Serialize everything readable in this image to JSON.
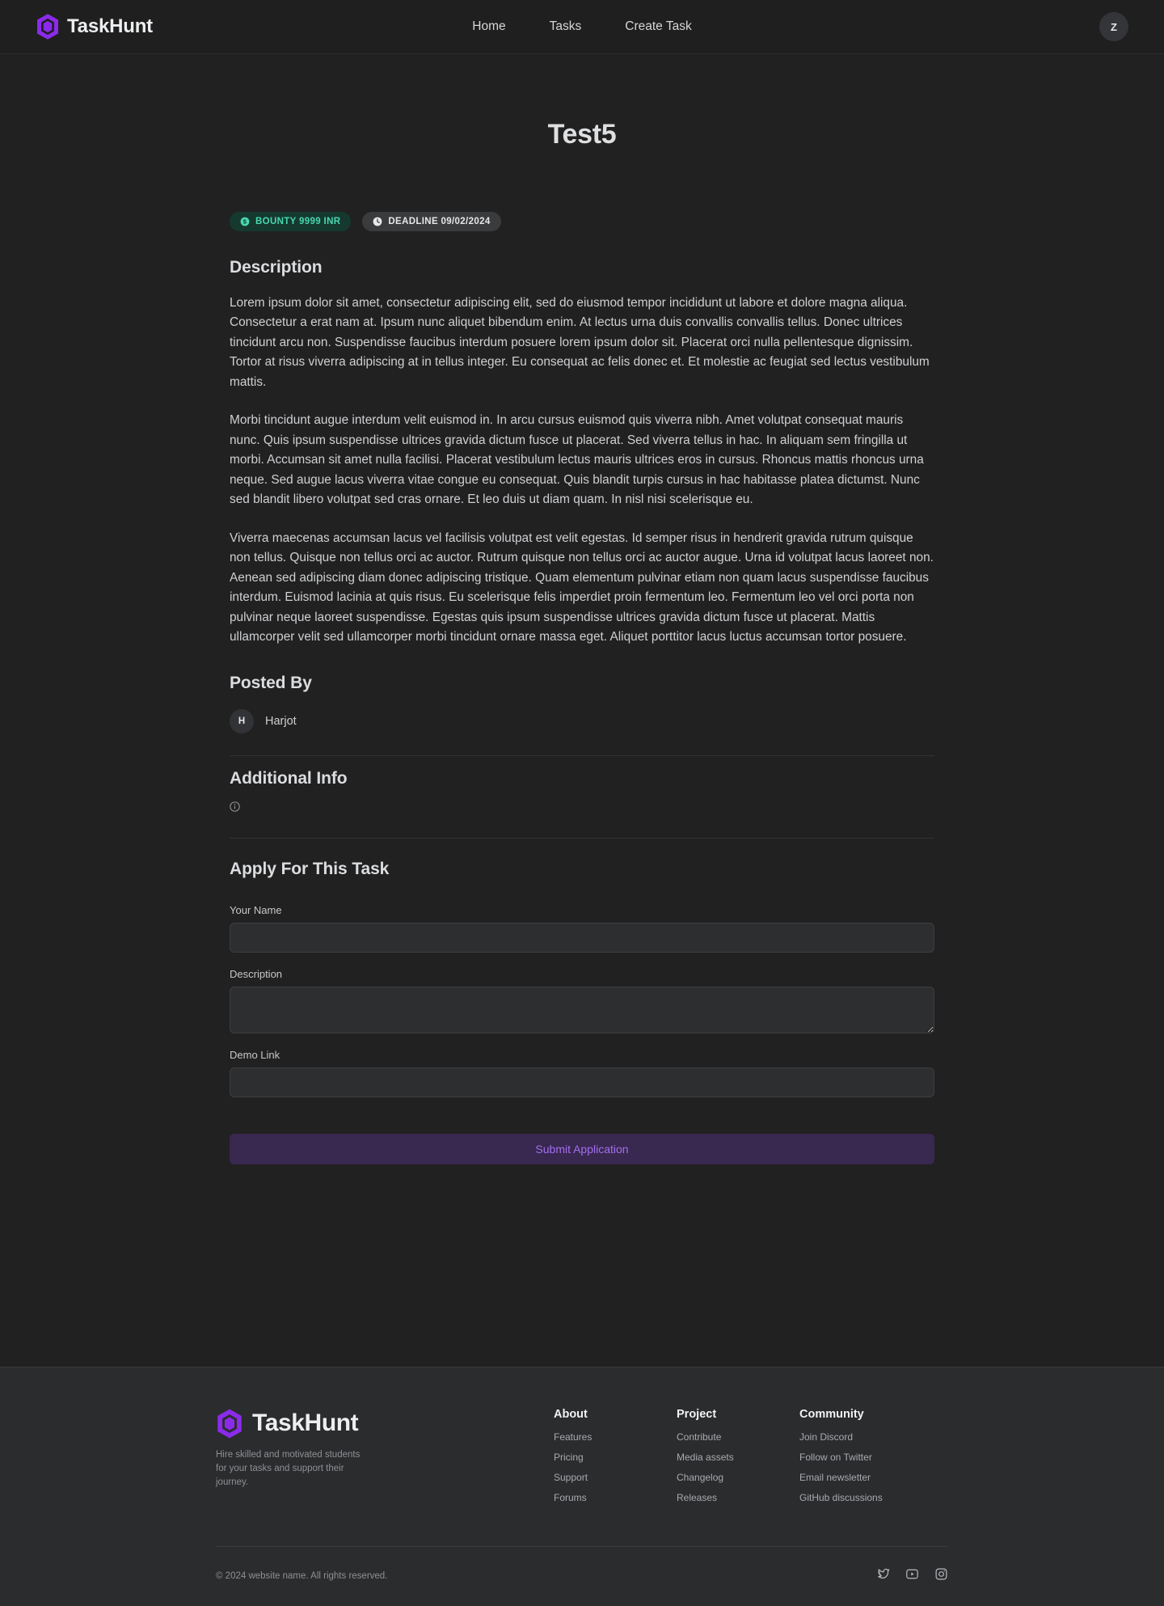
{
  "header": {
    "brand_name": "TaskHunt",
    "nav": [
      {
        "label": "Home"
      },
      {
        "label": "Tasks"
      },
      {
        "label": "Create Task"
      }
    ],
    "avatar_initial": "Z"
  },
  "task": {
    "title": "Test5",
    "badges": {
      "bounty": "BOUNTY 9999 INR",
      "deadline": "DEADLINE 09/02/2024"
    },
    "description_heading": "Description",
    "description_paragraphs": [
      "Lorem ipsum dolor sit amet, consectetur adipiscing elit, sed do eiusmod tempor incididunt ut labore et dolore magna aliqua. Consectetur a erat nam at. Ipsum nunc aliquet bibendum enim. At lectus urna duis convallis convallis tellus. Donec ultrices tincidunt arcu non. Suspendisse faucibus interdum posuere lorem ipsum dolor sit. Placerat orci nulla pellentesque dignissim. Tortor at risus viverra adipiscing at in tellus integer. Eu consequat ac felis donec et. Et molestie ac feugiat sed lectus vestibulum mattis.",
      "Morbi tincidunt augue interdum velit euismod in. In arcu cursus euismod quis viverra nibh. Amet volutpat consequat mauris nunc. Quis ipsum suspendisse ultrices gravida dictum fusce ut placerat. Sed viverra tellus in hac. In aliquam sem fringilla ut morbi. Accumsan sit amet nulla facilisi. Placerat vestibulum lectus mauris ultrices eros in cursus. Rhoncus mattis rhoncus urna neque. Sed augue lacus viverra vitae congue eu consequat. Quis blandit turpis cursus in hac habitasse platea dictumst. Nunc sed blandit libero volutpat sed cras ornare. Et leo duis ut diam quam. In nisl nisi scelerisque eu.",
      "Viverra maecenas accumsan lacus vel facilisis volutpat est velit egestas. Id semper risus in hendrerit gravida rutrum quisque non tellus. Quisque non tellus orci ac auctor. Rutrum quisque non tellus orci ac auctor augue. Urna id volutpat lacus laoreet non. Aenean sed adipiscing diam donec adipiscing tristique. Quam elementum pulvinar etiam non quam lacus suspendisse faucibus interdum. Euismod lacinia at quis risus. Eu scelerisque felis imperdiet proin fermentum leo. Fermentum leo vel orci porta non pulvinar neque laoreet suspendisse. Egestas quis ipsum suspendisse ultrices gravida dictum fusce ut placerat. Mattis ullamcorper velit sed ullamcorper morbi tincidunt ornare massa eget. Aliquet porttitor lacus luctus accumsan tortor posuere."
    ],
    "posted_by_heading": "Posted By",
    "poster_initial": "H",
    "poster_name": "Harjot",
    "additional_info_heading": "Additional Info",
    "additional_info_text": ""
  },
  "apply": {
    "heading": "Apply For This Task",
    "name_label": "Your Name",
    "name_value": "",
    "name_placeholder": "",
    "description_label": "Description",
    "description_value": "",
    "description_placeholder": "",
    "demo_label": "Demo Link",
    "demo_value": "",
    "demo_placeholder": "",
    "submit_label": "Submit Application"
  },
  "footer": {
    "brand_name": "TaskHunt",
    "tagline": "Hire skilled and motivated students for your tasks and support their journey.",
    "columns": [
      {
        "title": "About",
        "links": [
          {
            "label": "Features"
          },
          {
            "label": "Pricing"
          },
          {
            "label": "Support"
          },
          {
            "label": "Forums"
          }
        ]
      },
      {
        "title": "Project",
        "links": [
          {
            "label": "Contribute"
          },
          {
            "label": "Media assets"
          },
          {
            "label": "Changelog"
          },
          {
            "label": "Releases"
          }
        ]
      },
      {
        "title": "Community",
        "links": [
          {
            "label": "Join Discord"
          },
          {
            "label": "Follow on Twitter"
          },
          {
            "label": "Email newsletter"
          },
          {
            "label": "GitHub discussions"
          }
        ]
      }
    ],
    "copyright": "© 2024 website name. All rights reserved.",
    "social": [
      {
        "name": "twitter-icon"
      },
      {
        "name": "youtube-icon"
      },
      {
        "name": "instagram-icon"
      }
    ]
  },
  "colors": {
    "page_bg": "#212121",
    "header_bg": "#1f1f1f",
    "footer_bg": "#2b2c2e",
    "brand_purple": "#8b2bea",
    "bounty_text": "#49d7b0",
    "bounty_bg": "#15392f",
    "submit_bg": "#39284f",
    "submit_text": "#a36ff0"
  }
}
